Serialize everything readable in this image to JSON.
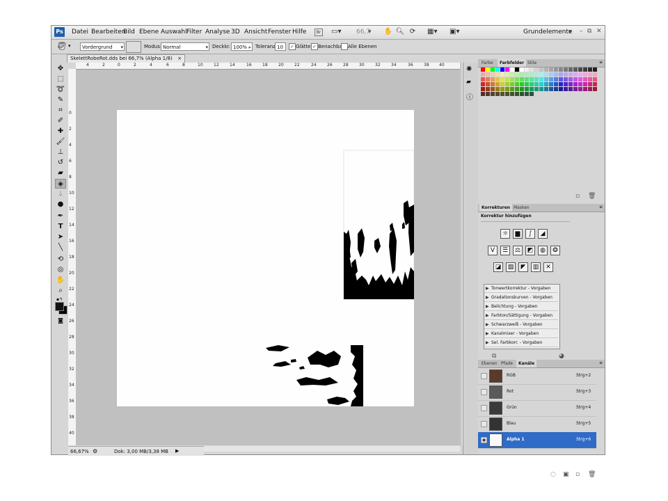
{
  "app": {
    "logo": "Ps",
    "workspace": "Grundelemente",
    "zoom_field": "66,7"
  },
  "menu": {
    "items": [
      "Datei",
      "Bearbeiten",
      "Bild",
      "Ebene",
      "Auswahl",
      "Filter",
      "Analyse",
      "3D",
      "Ansicht",
      "Fenster",
      "Hilfe"
    ]
  },
  "options": {
    "fill_source": "Vordergrund",
    "mode_label": "Modus:",
    "mode_value": "Normal",
    "opacity_label": "Deckkr.:",
    "opacity_value": "100%",
    "tolerance_label": "Toleranz:",
    "tolerance_value": "10",
    "antialias_label": "Glätten",
    "contiguous_label": "Benachbart",
    "all_layers_label": "Alle Ebenen"
  },
  "document": {
    "tab_title": "SkelettRobeRot.dds bei 66,7% (Alpha 1/8)",
    "close": "×"
  },
  "ruler_h": [
    "4",
    "2",
    "0",
    "2",
    "4",
    "6",
    "8",
    "10",
    "12",
    "14",
    "16",
    "18",
    "20",
    "22",
    "24",
    "26",
    "28",
    "30",
    "32",
    "34",
    "36",
    "38",
    "40"
  ],
  "ruler_v": [
    "0",
    "2",
    "4",
    "6",
    "8",
    "10",
    "12",
    "14",
    "16",
    "18",
    "20",
    "22",
    "24",
    "26",
    "28",
    "30",
    "32",
    "34",
    "36",
    "38",
    "40"
  ],
  "status": {
    "zoom": "66,67%",
    "doc": "Dok: 3,00 MB/3,38 MB"
  },
  "swatch_panel": {
    "tabs": [
      "Farbe",
      "Farbfelder",
      "Stile"
    ],
    "active_tab": "Farbfelder"
  },
  "adjust_panel": {
    "tabs": [
      "Korrekturen",
      "Masken"
    ],
    "active_tab": "Korrekturen",
    "heading": "Korrektur hinzufügen",
    "presets": [
      "Tonwertkorrektur - Vorgaben",
      "Gradationskurven - Vorgaben",
      "Belichtung - Vorgaben",
      "Farbton/Sättigung - Vorgaben",
      "Schwarzweiß - Vorgaben",
      "Kanalmixer - Vorgaben",
      "Sel. Farbkorr. - Vorgaben"
    ]
  },
  "channels_panel": {
    "tabs": [
      "Ebenen",
      "Pfade",
      "Kanäle"
    ],
    "active_tab": "Kanäle",
    "rows": [
      {
        "name": "RGB",
        "shortcut": "Strg+2"
      },
      {
        "name": "Rot",
        "shortcut": "Strg+3"
      },
      {
        "name": "Grün",
        "shortcut": "Strg+4"
      },
      {
        "name": "Blau",
        "shortcut": "Strg+5"
      },
      {
        "name": "Alpha 1",
        "shortcut": "Strg+6"
      }
    ]
  },
  "colors": {
    "selected_row": "#2f6bc7",
    "canvas_bg": "#c0c0c0",
    "ps_blue": "#1e5fa8"
  }
}
